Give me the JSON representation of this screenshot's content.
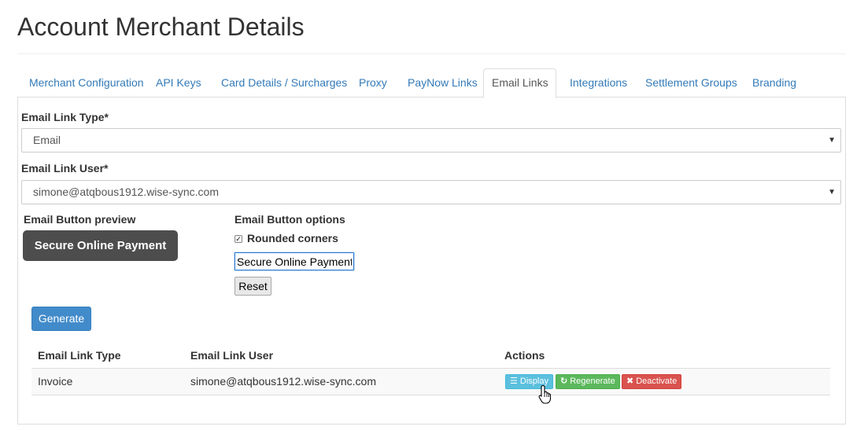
{
  "page": {
    "title": "Account Merchant Details"
  },
  "tabs": [
    {
      "label": "Merchant Configuration"
    },
    {
      "label": "API Keys"
    },
    {
      "label": "Card Details / Surcharges"
    },
    {
      "label": "Proxy"
    },
    {
      "label": "PayNow Links"
    },
    {
      "label": "Email Links",
      "active": true
    },
    {
      "label": "Integrations"
    },
    {
      "label": "Settlement Groups"
    },
    {
      "label": "Branding"
    }
  ],
  "form": {
    "link_type_label": "Email Link Type*",
    "link_type_value": "Email",
    "link_user_label": "Email Link User*",
    "link_user_value": "simone@atqbous1912.wise-sync.com",
    "preview_label": "Email Button preview",
    "preview_button_text": "Secure Online Payment",
    "options_label": "Email Button options",
    "rounded_corners_label": "Rounded corners",
    "rounded_corners_checked": true,
    "button_text_value": "Secure Online Payment",
    "reset_label": "Reset",
    "generate_label": "Generate"
  },
  "table": {
    "headers": [
      "Email Link Type",
      "Email Link User",
      "Actions"
    ],
    "rows": [
      {
        "type": "Invoice",
        "user": "simone@atqbous1912.wise-sync.com",
        "actions": {
          "display": "Display",
          "regenerate": "Regenerate",
          "deactivate": "Deactivate"
        }
      }
    ]
  },
  "colors": {
    "link": "#337ab7",
    "primary": "#428bca",
    "info": "#5bc0de",
    "success": "#5cb85c",
    "danger": "#d9534f",
    "preview_button": "#4d4d4d"
  },
  "icons": {
    "select_caret": "caret-down-icon",
    "display": "list-icon",
    "regenerate": "refresh-icon",
    "deactivate": "close-icon",
    "cursor": "hand-pointer-icon"
  }
}
